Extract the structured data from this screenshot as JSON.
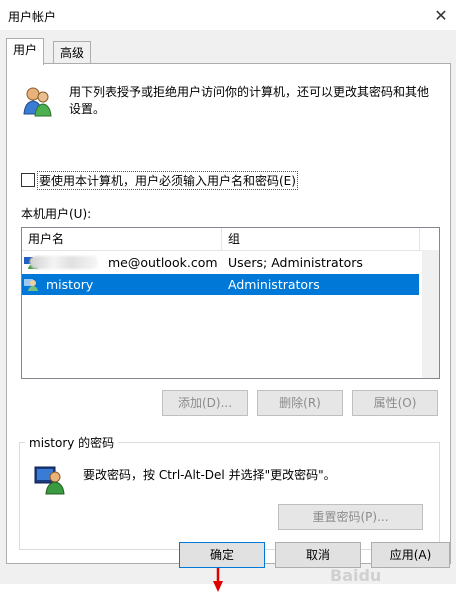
{
  "window": {
    "title": "用户帐户",
    "close_glyph": "✕"
  },
  "tabs": [
    {
      "label": "用户",
      "active": true
    },
    {
      "label": "高级",
      "active": false
    }
  ],
  "intro_text_line1": "用下列表授予或拒绝用户访问你的计算机，还可以更改其密码和其他",
  "intro_text_line2": "设置。",
  "require_login": {
    "label": "要使用本计算机，用户必须输入用户名和密码(E)",
    "checked": false
  },
  "users_label": "本机用户(U):",
  "users_table": {
    "columns": [
      "用户名",
      "组"
    ],
    "rows": [
      {
        "name": "me@outlook.com",
        "group": "Users; Administrators",
        "selected": false
      },
      {
        "name": "mistory",
        "group": "Administrators",
        "selected": true
      }
    ]
  },
  "buttons": {
    "add": "添加(D)...",
    "remove": "删除(R)",
    "properties": "属性(O)",
    "reset_password": "重置密码(P)...",
    "ok": "确定",
    "cancel": "取消",
    "apply": "应用(A)"
  },
  "password_group": {
    "title": "mistory 的密码",
    "text": "要改密码，按 Ctrl-Alt-Del 并选择\"更改密码\"。"
  },
  "colors": {
    "accent": "#0078d7",
    "annotation_arrow": "#e00000"
  },
  "icons": [
    "users-icon",
    "user-row-icon",
    "password-user-icon",
    "close-icon"
  ],
  "watermark_text": "Baidu"
}
